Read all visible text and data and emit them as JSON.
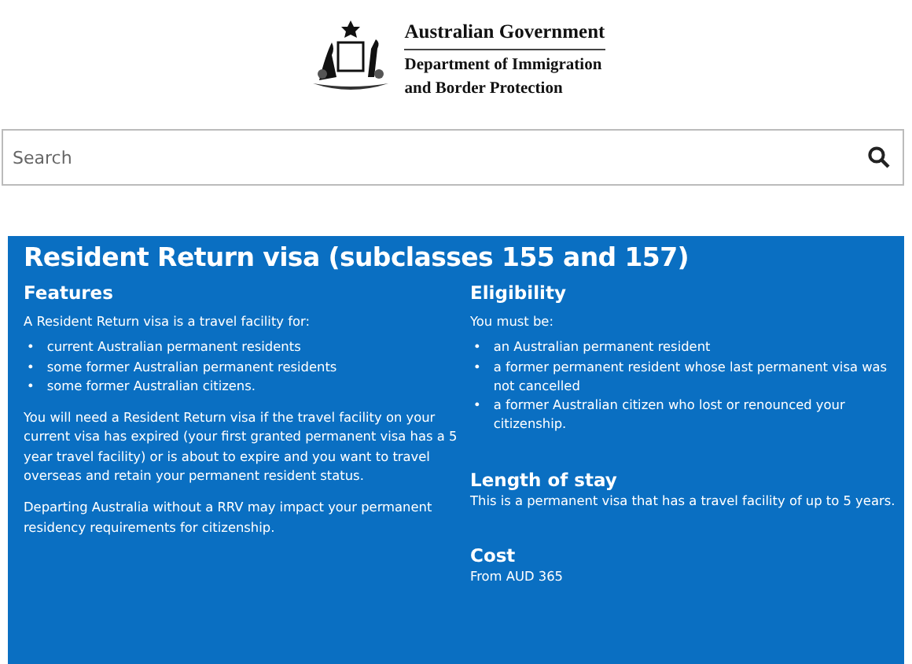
{
  "header": {
    "lines": [
      "Australian Government",
      "Department of Immigration",
      "and Border Protection"
    ]
  },
  "search": {
    "placeholder": "Search"
  },
  "panel": {
    "title": "Resident Return visa (subclasses 155 and 157)",
    "left": {
      "heading": "Features",
      "intro": "A Resident Return visa is a travel facility for:",
      "bullets": [
        {
          "marker": "•",
          "text": "current Australian permanent residents"
        },
        {
          "marker": "•",
          "text": "some former Australian permanent residents"
        },
        {
          "marker": "•",
          "text": "some former Australian citizens."
        }
      ],
      "paragraphs": [
        "You will need a Resident Return visa if the travel facility on your current visa has expired (your first granted permanent visa has a 5 year travel facility) or is about to expire and you want to travel overseas and retain your permanent resident status.",
        "Departing Australia without a RRV may impact your permanent residency requirements for citizenship."
      ]
    },
    "right": {
      "heading": "Eligibility",
      "intro": "You must be:",
      "bullets": [
        {
          "marker": "•",
          "text": "an Australian permanent resident"
        },
        {
          "marker": "•",
          "text": "a former permanent resident whose last permanent visa was not cancelled"
        },
        {
          "marker": "•",
          "text": "a former Australian citizen who lost or renounced your citizenship."
        }
      ],
      "sections": [
        {
          "heading": "Length of stay",
          "text": "This is a permanent visa that has a travel facility of up to 5 years."
        },
        {
          "heading": "Cost",
          "text": "From AUD 365"
        }
      ]
    }
  }
}
